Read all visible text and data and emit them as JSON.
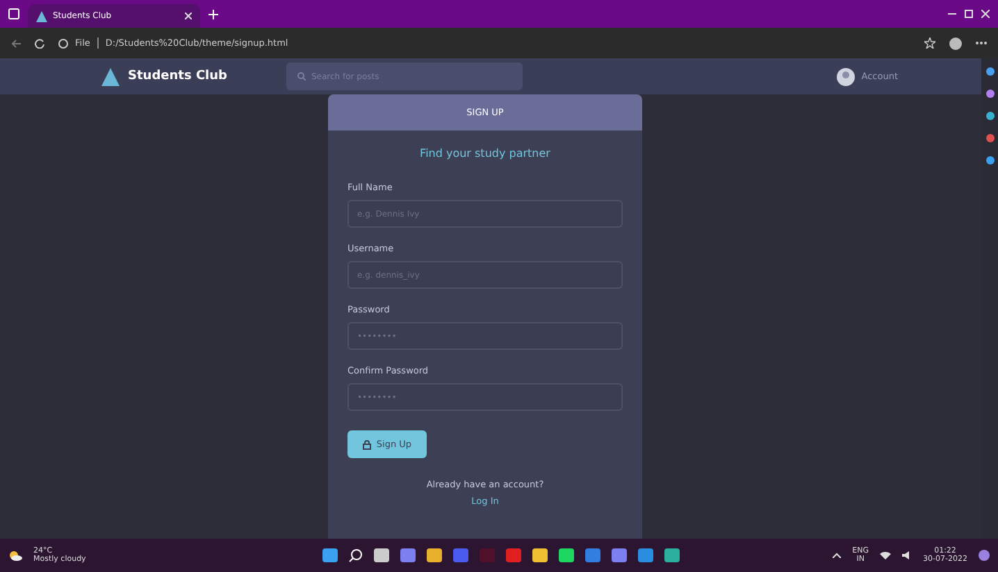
{
  "browser": {
    "tab_title": "Students Club",
    "address_scheme": "File",
    "address": "D:/Students%20Club/theme/signup.html"
  },
  "site": {
    "brand": "Students Club",
    "search_placeholder": "Search for posts",
    "account": "Account"
  },
  "signup": {
    "header": "SIGN UP",
    "title": "Find your study partner",
    "fields": [
      {
        "label": "Full Name",
        "placeholder": "e.g. Dennis Ivy"
      },
      {
        "label": "Username",
        "placeholder": "e.g. dennis_ivy"
      },
      {
        "label": "Password",
        "placeholder": "••••••••"
      },
      {
        "label": "Confirm Password",
        "placeholder": "••••••••"
      }
    ],
    "button": "Sign Up",
    "footer": "Already have an account?",
    "link": "Log In"
  },
  "taskbar": {
    "temperature": "24°C",
    "weather": "Mostly cloudy",
    "language": "ENG",
    "region": "IN",
    "time": "01:22",
    "date": "30-07-2022"
  }
}
